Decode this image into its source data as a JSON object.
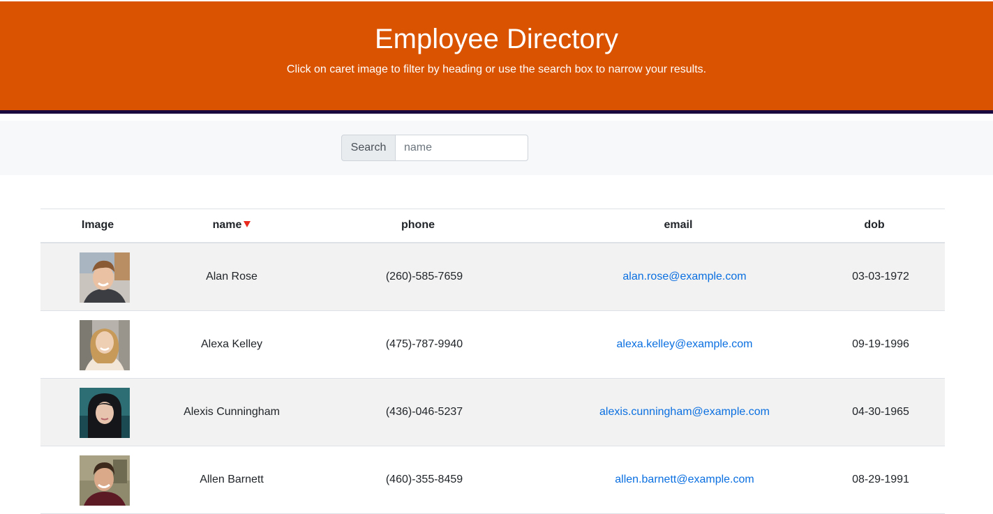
{
  "header": {
    "title": "Employee Directory",
    "subtitle": "Click on caret image to filter by heading or use the search box to narrow your results."
  },
  "search": {
    "label": "Search",
    "placeholder": "name",
    "value": ""
  },
  "table": {
    "columns": [
      "Image",
      "name",
      "phone",
      "email",
      "dob"
    ],
    "sorted_column": "name",
    "sort_icon": "caret-down-icon",
    "rows": [
      {
        "name": "Alan Rose",
        "phone": "(260)-585-7659",
        "email": "alan.rose@example.com",
        "dob": "03-03-1972"
      },
      {
        "name": "Alexa Kelley",
        "phone": "(475)-787-9940",
        "email": "alexa.kelley@example.com",
        "dob": "09-19-1996"
      },
      {
        "name": "Alexis Cunningham",
        "phone": "(436)-046-5237",
        "email": "alexis.cunningham@example.com",
        "dob": "04-30-1965"
      },
      {
        "name": "Allen Barnett",
        "phone": "(460)-355-8459",
        "email": "allen.barnett@example.com",
        "dob": "08-29-1991"
      }
    ]
  },
  "colors": {
    "header_bg": "#d95300",
    "header_rule": "#1a0a3f",
    "link": "#0a6fe0",
    "caret": "#e8281d",
    "striped_row": "#f2f2f2"
  }
}
